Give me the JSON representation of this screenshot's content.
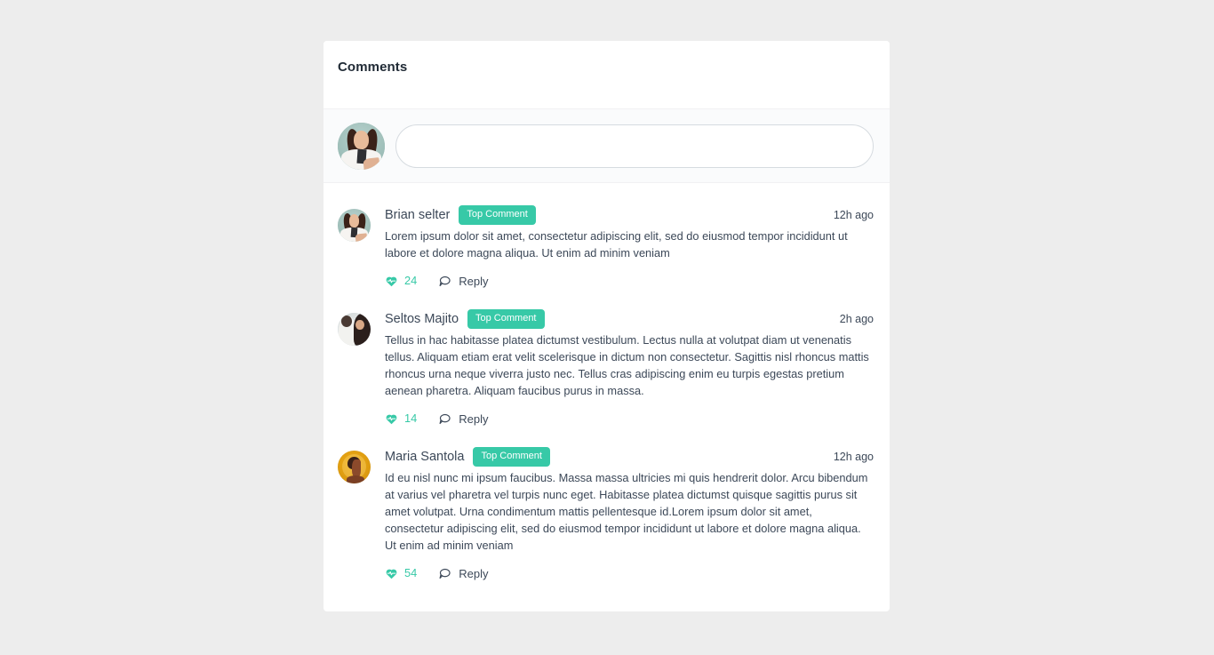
{
  "page": {
    "background_color": "#ededed",
    "accent_color": "#37c9a7",
    "text_color": "#3c4858"
  },
  "card": {
    "header": {
      "title": "Comments"
    },
    "composer": {
      "avatar_name": "current-user-avatar",
      "avatar_art": "woman-sage-background",
      "input_value": "",
      "input_placeholder": ""
    },
    "comments": [
      {
        "avatar_art": "woman-sage-background",
        "author": "Brian selter",
        "badge": "Top Comment",
        "time": "12h ago",
        "text": "Lorem ipsum dolor sit amet, consectetur adipiscing elit, sed do eiusmod tempor incididunt ut labore et dolore magna aliqua. Ut enim ad minim veniam",
        "like_count": "24",
        "reply_label": "Reply"
      },
      {
        "avatar_art": "couple-photo",
        "author": "Seltos Majito",
        "badge": "Top Comment",
        "time": "2h ago",
        "text": "Tellus in hac habitasse platea dictumst vestibulum. Lectus nulla at volutpat diam ut venenatis tellus. Aliquam etiam erat velit scelerisque in dictum non consectetur. Sagittis nisl rhoncus mattis rhoncus urna neque viverra justo nec. Tellus cras adipiscing enim eu turpis egestas pretium aenean pharetra. Aliquam faucibus purus in massa.",
        "like_count": "14",
        "reply_label": "Reply"
      },
      {
        "avatar_art": "illustrated-woman-amber",
        "author": "Maria Santola",
        "badge": "Top Comment",
        "time": "12h ago",
        "text": "Id eu nisl nunc mi ipsum faucibus. Massa massa ultricies mi quis hendrerit dolor. Arcu bibendum at varius vel pharetra vel turpis nunc eget. Habitasse platea dictumst quisque sagittis purus sit amet volutpat. Urna condimentum mattis pellentesque id.Lorem ipsum dolor sit amet, consectetur adipiscing elit, sed do eiusmod tempor incididunt ut labore et dolore magna aliqua. Ut enim ad minim veniam",
        "like_count": "54",
        "reply_label": "Reply"
      }
    ],
    "icons": {
      "like": "heart-pulse-icon",
      "reply": "speech-bubble-icon"
    }
  }
}
